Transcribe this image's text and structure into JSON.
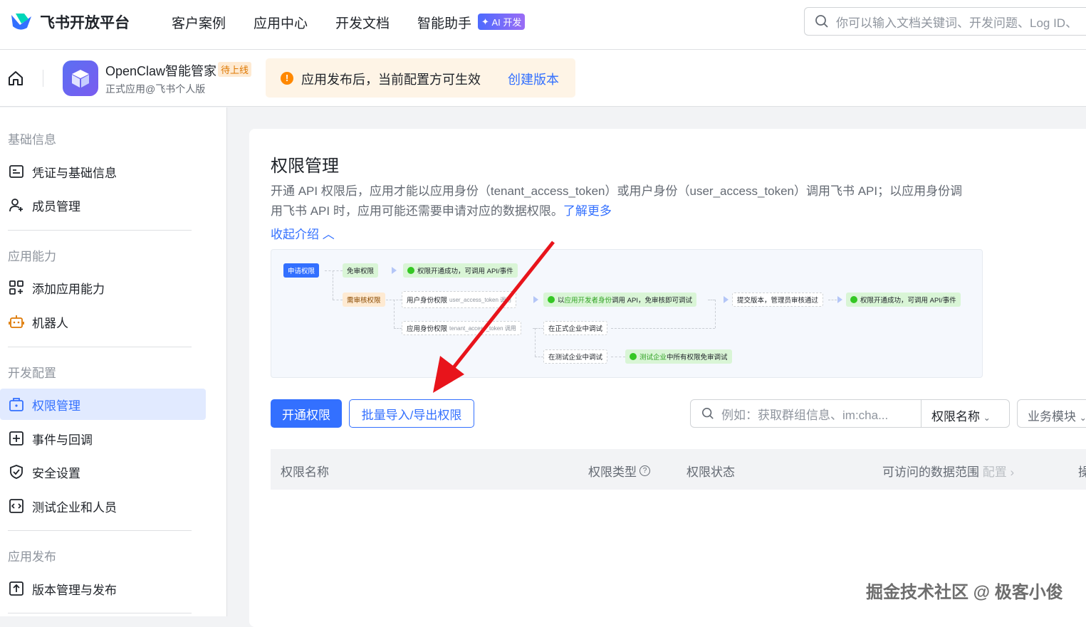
{
  "header": {
    "brand": "飞书开放平台",
    "nav": [
      "客户案例",
      "应用中心",
      "开发文档",
      "智能助手"
    ],
    "ai_badge": "AI 开发",
    "search_placeholder": "你可以输入文档关键词、开发问题、Log ID、"
  },
  "app": {
    "name": "OpenClaw智能管家",
    "status_badge": "待上线",
    "subtitle": "正式应用@飞书个人版",
    "notice": "应用发布后，当前配置方可生效",
    "notice_action": "创建版本"
  },
  "sidebar": {
    "sections": [
      {
        "title": "基础信息",
        "items": [
          {
            "label": "凭证与基础信息"
          },
          {
            "label": "成员管理"
          }
        ]
      },
      {
        "title": "应用能力",
        "items": [
          {
            "label": "添加应用能力"
          },
          {
            "label": "机器人"
          }
        ]
      },
      {
        "title": "开发配置",
        "items": [
          {
            "label": "权限管理",
            "active": true
          },
          {
            "label": "事件与回调"
          },
          {
            "label": "安全设置"
          },
          {
            "label": "测试企业和人员"
          }
        ]
      },
      {
        "title": "应用发布",
        "items": [
          {
            "label": "版本管理与发布"
          }
        ]
      }
    ]
  },
  "main": {
    "title": "权限管理",
    "desc_1": "开通 API 权限后，应用才能以应用身份（tenant_access_token）或用户身份（user_access_token）调用飞书 API；以应用身份调",
    "desc_2": "用飞书 API 时，应用可能还需要申请对应的数据权限。",
    "learn_more": "了解更多",
    "collapse": "收起介绍",
    "diagram": {
      "apply": "申请权限",
      "free": "免审权限",
      "success": "权限开通成功，可调用 API/事件",
      "review": "需审核权限",
      "user_perm": "用户身份权限",
      "user_token": "user_access_token 调用",
      "dev_call_pre": "以",
      "dev_call_hl": "应用开发者身份",
      "dev_call_post": "调用 API，免审核即可调试",
      "submit": "提交版本，管理员审核通过",
      "success2": "权限开通成功，可调用 API/事件",
      "app_perm": "应用身份权限",
      "app_token": "tenant_access_token 调用",
      "formal": "在正式企业中调试",
      "test": "在测试企业中调试",
      "test_free_hl": "测试企业",
      "test_free_post": "中所有权限免审调试"
    },
    "btn_open": "开通权限",
    "btn_batch": "批量导入/导出权限",
    "search_placeholder": "例如：获取群组信息、im:cha...",
    "filter_name": "权限名称",
    "filter_module": "业务模块",
    "columns": [
      "权限名称",
      "权限类型",
      "权限状态",
      "可访问的数据范围",
      "配置",
      "操作"
    ]
  },
  "watermark": "掘金技术社区 @ 极客小俊",
  "colors": {
    "primary": "#3370ff",
    "annotation_arrow": "#e8141b"
  }
}
